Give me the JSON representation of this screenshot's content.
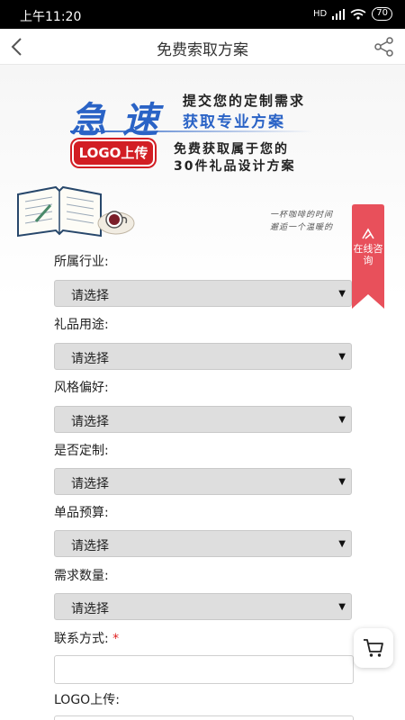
{
  "status_bar": {
    "time": "上午11:20",
    "network": "HD",
    "battery": "70"
  },
  "nav": {
    "title": "免费索取方案"
  },
  "banner": {
    "char1": "急",
    "char2": "速",
    "line1": "提交您的定制需求",
    "line2": "获取专业方案",
    "logo_button": "LOGO上传",
    "line3": "免费获取属于您的",
    "line4": "30件礼品设计方案"
  },
  "decor": {
    "poem_line1": "一杯咖啡的时间",
    "poem_line2": "邂逅一个温暖的"
  },
  "consult": {
    "label": "在线咨询"
  },
  "form": {
    "fields": [
      {
        "label": "所属行业:",
        "value": "请选择"
      },
      {
        "label": "礼品用途:",
        "value": "请选择"
      },
      {
        "label": "风格偏好:",
        "value": "请选择"
      },
      {
        "label": "是否定制:",
        "value": "请选择"
      },
      {
        "label": "单品预算:",
        "value": "请选择"
      },
      {
        "label": "需求数量:",
        "value": "请选择"
      }
    ],
    "contact": {
      "label": "联系方式:",
      "required_mark": "*",
      "value": ""
    },
    "logo_upload": {
      "label": "LOGO上传:"
    }
  },
  "colors": {
    "accent_blue": "#2a63c6",
    "logo_red": "#d21e24",
    "consult_red": "#e8505b"
  },
  "icons": [
    "back-icon",
    "share-icon",
    "cart-icon",
    "wifi-icon",
    "signal-icon",
    "battery-icon"
  ]
}
